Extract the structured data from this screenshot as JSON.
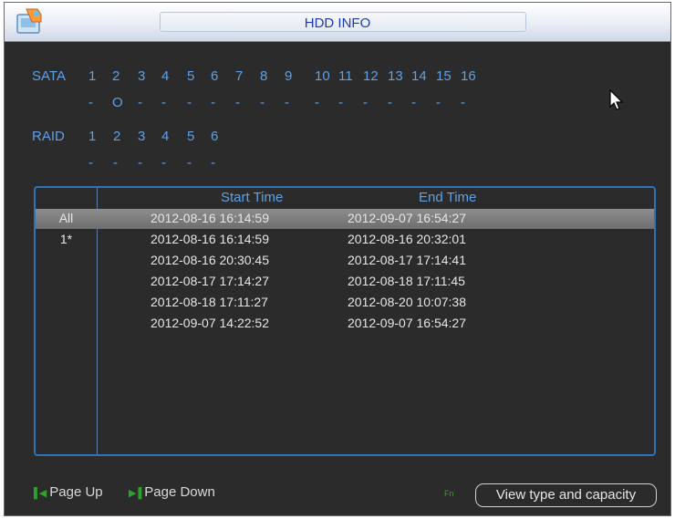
{
  "window": {
    "title": "HDD INFO"
  },
  "sata": {
    "label": "SATA",
    "ports": [
      "1",
      "2",
      "3",
      "4",
      "5",
      "6",
      "7",
      "8",
      "9",
      "10",
      "11",
      "12",
      "13",
      "14",
      "15",
      "16"
    ],
    "status": [
      "-",
      "O",
      "-",
      "-",
      "-",
      "-",
      "-",
      "-",
      "-",
      "-",
      "-",
      "-",
      "-",
      "-",
      "-",
      "-"
    ]
  },
  "raid": {
    "label": "RAID",
    "ports": [
      "1",
      "2",
      "3",
      "4",
      "5",
      "6"
    ],
    "status": [
      "-",
      "-",
      "-",
      "-",
      "-",
      "-"
    ]
  },
  "table": {
    "headers": {
      "start": "Start Time",
      "end": "End Time"
    },
    "rows": [
      {
        "index": "All",
        "start": "2012-08-16 16:14:59",
        "end": "2012-09-07 16:54:27",
        "selected": true
      },
      {
        "index": "1*",
        "start": "2012-08-16 16:14:59",
        "end": "2012-08-16 20:32:01"
      },
      {
        "index": "",
        "start": "2012-08-16 20:30:45",
        "end": "2012-08-17 17:14:41"
      },
      {
        "index": "",
        "start": "2012-08-17 17:14:27",
        "end": "2012-08-18 17:11:45"
      },
      {
        "index": "",
        "start": "2012-08-18 17:11:27",
        "end": "2012-08-20 10:07:38"
      },
      {
        "index": "",
        "start": "2012-09-07 14:22:52",
        "end": "2012-09-07 16:54:27"
      }
    ]
  },
  "footer": {
    "page_up": "Page Up",
    "page_down": "Page Down",
    "fn": "Fn",
    "view_button": "View type and capacity"
  }
}
